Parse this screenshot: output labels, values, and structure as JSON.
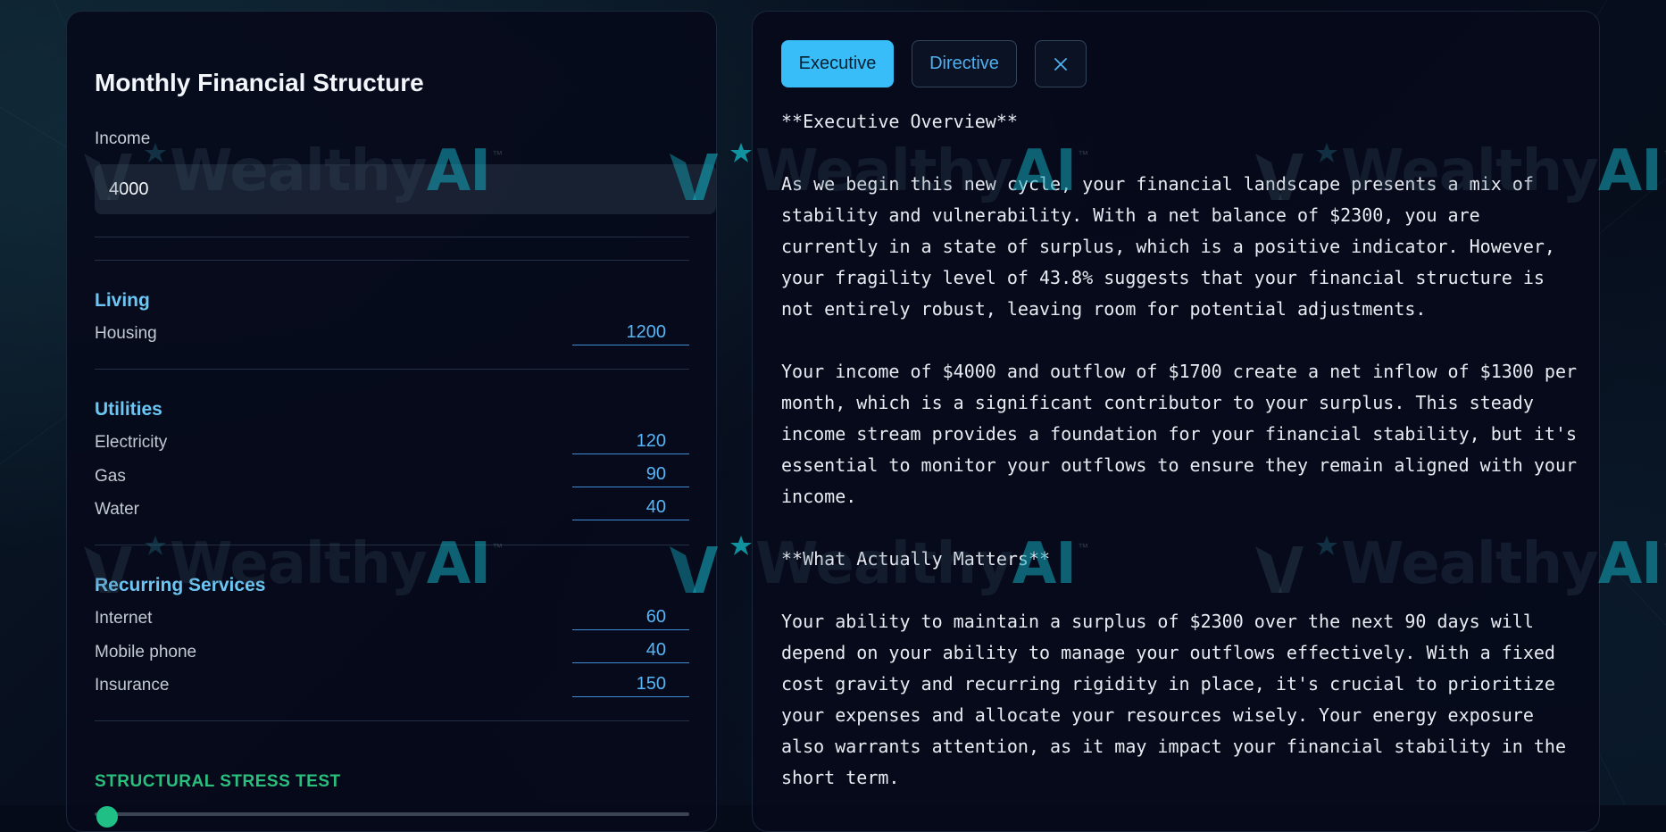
{
  "left_panel": {
    "title": "Monthly Financial Structure",
    "income": {
      "label": "Income",
      "value": "4000"
    },
    "sections": [
      {
        "title": "Living",
        "rows": [
          {
            "label": "Housing",
            "value": "1200"
          }
        ]
      },
      {
        "title": "Utilities",
        "rows": [
          {
            "label": "Electricity",
            "value": "120"
          },
          {
            "label": "Gas",
            "value": "90"
          },
          {
            "label": "Water",
            "value": "40"
          }
        ]
      },
      {
        "title": "Recurring Services",
        "rows": [
          {
            "label": "Internet",
            "value": "60"
          },
          {
            "label": "Mobile phone",
            "value": "40"
          },
          {
            "label": "Insurance",
            "value": "150"
          }
        ]
      }
    ],
    "stress_test": {
      "title": "STRUCTURAL STRESS TEST",
      "slider_level": 0
    }
  },
  "right_panel": {
    "tabs": {
      "executive": "Executive",
      "directive": "Directive",
      "active": "executive"
    },
    "close_icon": "close-icon",
    "report": [
      "**Executive Overview**",
      "As we begin this new cycle, your financial landscape presents a mix of stability and vulnerability. With a net balance of $2300, you are currently in a state of surplus, which is a positive indicator. However, your fragility level of 43.8% suggests that your financial structure is not entirely robust, leaving room for potential adjustments.",
      "Your income of $4000 and outflow of $1700 create a net inflow of $1300 per month, which is a significant contributor to your surplus. This steady income stream provides a foundation for your financial stability, but it's essential to monitor your outflows to ensure they remain aligned with your income.",
      "**What Actually Matters**",
      "Your ability to maintain a surplus of $2300 over the next 90 days will depend on your ability to manage your outflows effectively. With a fixed cost gravity and recurring rigidity in place, it's crucial to prioritize your expenses and allocate your resources wisely. Your energy exposure also warrants attention, as it may impact your financial stability in the short term."
    ]
  },
  "watermark": {
    "brand": "Wealthy",
    "brand_accent": "AI",
    "mark": "™",
    "logo_icon": "wealthyai-logo-icon"
  },
  "colors": {
    "background": "#060b1a",
    "accent": "#38bdf8",
    "section_title": "#6cc6f4",
    "input_value": "#58b6f6",
    "stress_title": "#2bbf7e"
  }
}
